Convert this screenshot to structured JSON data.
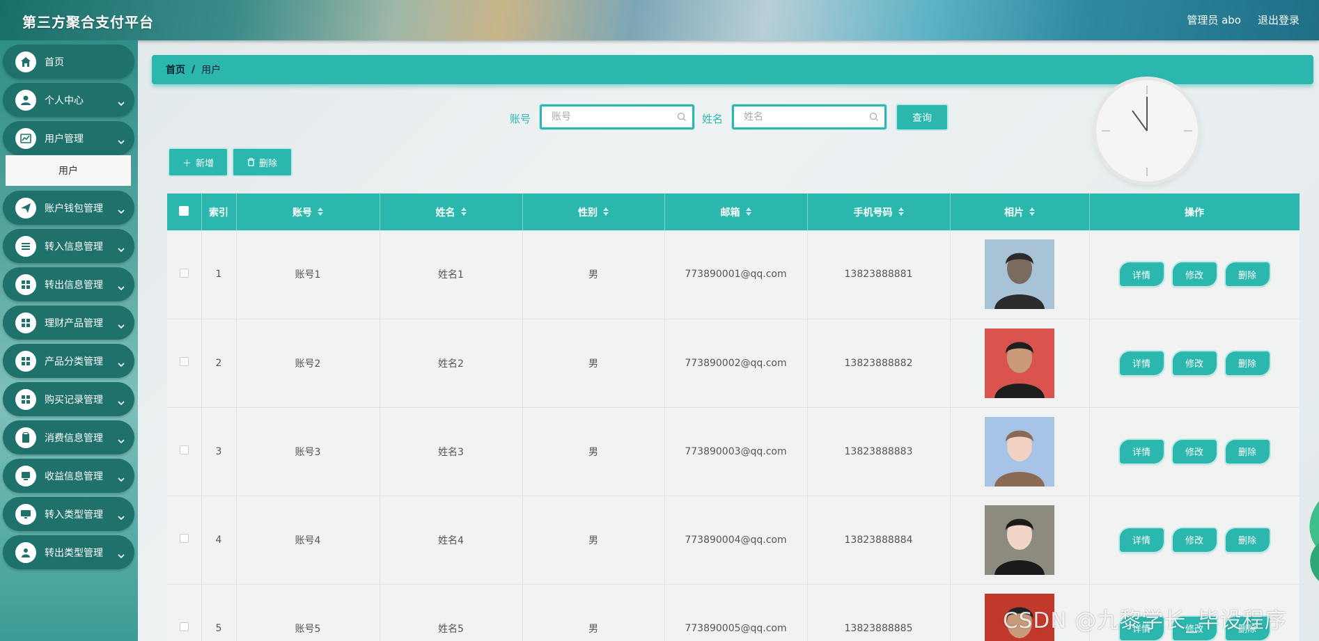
{
  "header": {
    "title": "第三方聚合支付平台",
    "user_label": "管理员 abo",
    "logout_label": "退出登录"
  },
  "sidebar": {
    "items": [
      {
        "label": "首页",
        "icon": "home-icon",
        "expandable": false
      },
      {
        "label": "个人中心",
        "icon": "user-icon",
        "expandable": true
      },
      {
        "label": "用户管理",
        "icon": "chart-icon",
        "expandable": true
      },
      {
        "label": "账户钱包管理",
        "icon": "send-icon",
        "expandable": true
      },
      {
        "label": "转入信息管理",
        "icon": "list-icon",
        "expandable": true
      },
      {
        "label": "转出信息管理",
        "icon": "grid-icon",
        "expandable": true
      },
      {
        "label": "理财产品管理",
        "icon": "grid-icon",
        "expandable": true
      },
      {
        "label": "产品分类管理",
        "icon": "grid-icon",
        "expandable": true
      },
      {
        "label": "购买记录管理",
        "icon": "grid-icon",
        "expandable": true
      },
      {
        "label": "消费信息管理",
        "icon": "clipboard-icon",
        "expandable": true
      },
      {
        "label": "收益信息管理",
        "icon": "monitor-icon",
        "expandable": true
      },
      {
        "label": "转入类型管理",
        "icon": "screen-icon",
        "expandable": true
      },
      {
        "label": "转出类型管理",
        "icon": "person-icon",
        "expandable": true
      }
    ],
    "submenu": {
      "label": "用户"
    }
  },
  "breadcrumb": {
    "home": "首页",
    "separator": "/",
    "current": "用户"
  },
  "search": {
    "account_label": "账号",
    "account_placeholder": "账号",
    "name_label": "姓名",
    "name_placeholder": "姓名",
    "query_label": "查询"
  },
  "actions": {
    "add_label": "新增",
    "delete_label": "删除"
  },
  "table": {
    "headers": [
      "索引",
      "账号",
      "姓名",
      "性别",
      "邮箱",
      "手机号码",
      "相片",
      "操作"
    ],
    "row_buttons": [
      "详情",
      "修改",
      "删除"
    ],
    "rows": [
      {
        "index": "1",
        "account": "账号1",
        "name": "姓名1",
        "gender": "男",
        "email": "773890001@qq.com",
        "phone": "13823888881"
      },
      {
        "index": "2",
        "account": "账号2",
        "name": "姓名2",
        "gender": "男",
        "email": "773890002@qq.com",
        "phone": "13823888882"
      },
      {
        "index": "3",
        "account": "账号3",
        "name": "姓名3",
        "gender": "男",
        "email": "773890003@qq.com",
        "phone": "13823888883"
      },
      {
        "index": "4",
        "account": "账号4",
        "name": "姓名4",
        "gender": "男",
        "email": "773890004@qq.com",
        "phone": "13823888884"
      },
      {
        "index": "5",
        "account": "账号5",
        "name": "姓名5",
        "gender": "男",
        "email": "773890005@qq.com",
        "phone": "13823888885"
      }
    ]
  },
  "watermark": "CSDN @九黎学长_毕设程序",
  "colors": {
    "accent": "#2bb7ad",
    "sidebar_item": "#1f726c"
  }
}
